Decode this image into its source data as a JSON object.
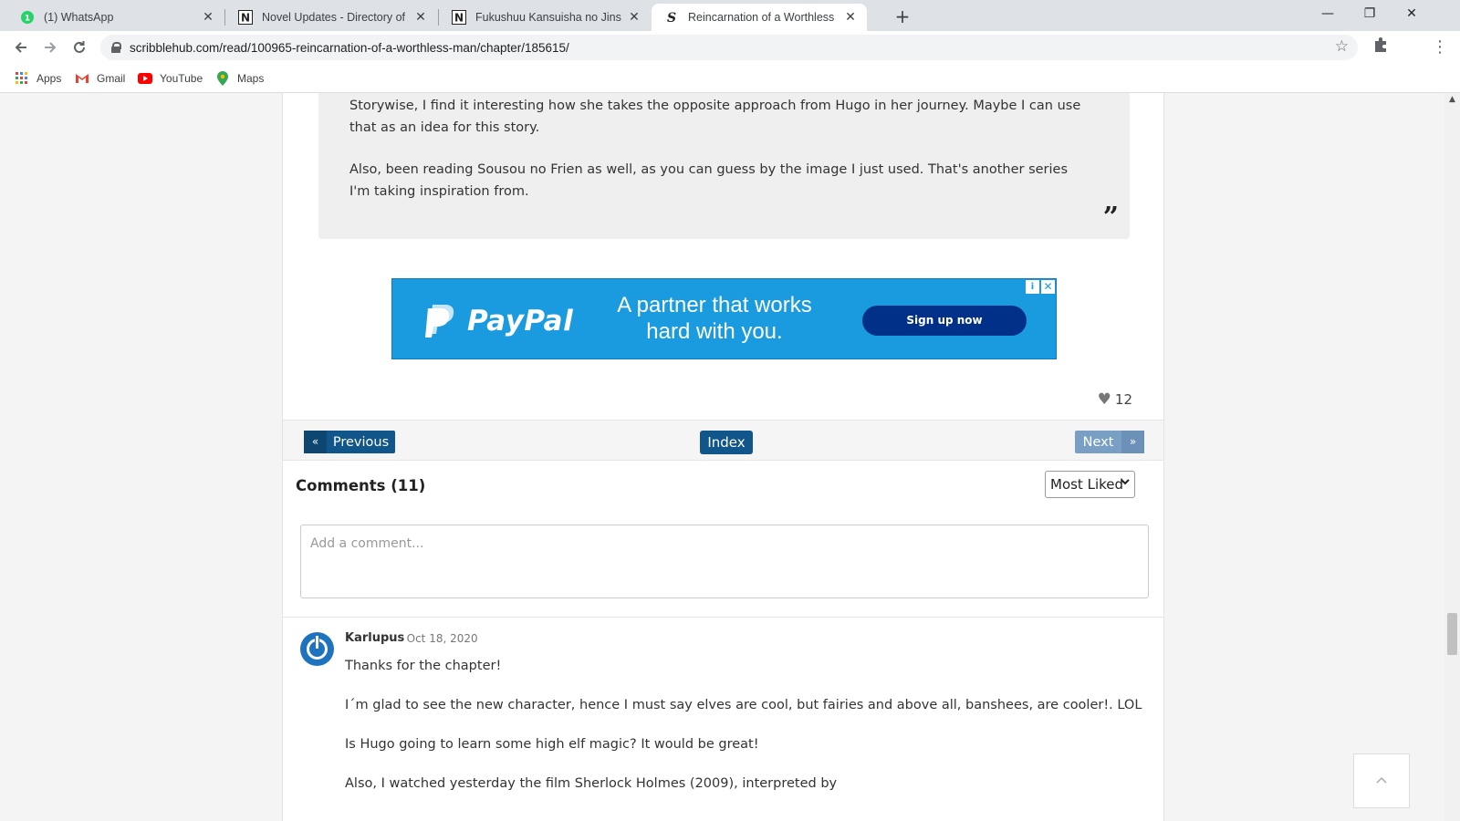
{
  "browser": {
    "tabs": [
      {
        "title": "(1) WhatsApp",
        "icon": "whatsapp-icon"
      },
      {
        "title": "Novel Updates - Directory of Asi",
        "icon": "novelupdates-icon"
      },
      {
        "title": "Fukushuu Kansuisha no Jinsei Ni",
        "icon": "novelupdates-icon"
      },
      {
        "title": "Reincarnation of a Worthless Ma",
        "icon": "scribblehub-icon",
        "active": true
      }
    ],
    "url": "scribblehub.com/read/100965-reincarnation-of-a-worthless-man/chapter/185615/",
    "bookmarks": [
      {
        "label": "Apps",
        "icon": "apps-grid-icon"
      },
      {
        "label": "Gmail",
        "icon": "gmail-icon"
      },
      {
        "label": "YouTube",
        "icon": "youtube-icon"
      },
      {
        "label": "Maps",
        "icon": "maps-icon"
      }
    ]
  },
  "authors_note": {
    "paragraph1": "Storywise, I find it interesting how she takes the opposite approach from Hugo in her journey. Maybe I can use that as an idea for this story.",
    "paragraph2": "Also, been reading Sousou no Frien as well, as you can guess by the image I just used. That's another series I'm taking inspiration from.",
    "quote_mark": "”"
  },
  "ad": {
    "brand": "PayPal",
    "slogan": "A partner that works hard with you.",
    "cta": "Sign up now",
    "brand_color": "#1a9be0",
    "cta_color": "#003087"
  },
  "chapter": {
    "likes": "12",
    "nav": {
      "prev_arrow": "«",
      "prev_label": "Previous",
      "index_label": "Index",
      "next_label": "Next",
      "next_arrow": "»"
    }
  },
  "comments": {
    "title": "Comments (11)",
    "sort_selected": "Most Liked",
    "placeholder": "Add a comment...",
    "items": [
      {
        "author": "Karlupus",
        "date": "· Oct 18, 2020",
        "lines": [
          "Thanks for the chapter!",
          "I´m glad to see the new character, hence I must say elves are cool, but fairies and above all, banshees, are cooler!. LOL",
          "Is Hugo going to learn some high elf magic? It would be great!",
          "Also, I watched yesterday the film Sherlock Holmes (2009), interpreted by"
        ]
      }
    ]
  },
  "colors": {
    "button_primary": "#11568a",
    "button_disabled": "#7a9fc4",
    "avatar": "#1e73be"
  }
}
